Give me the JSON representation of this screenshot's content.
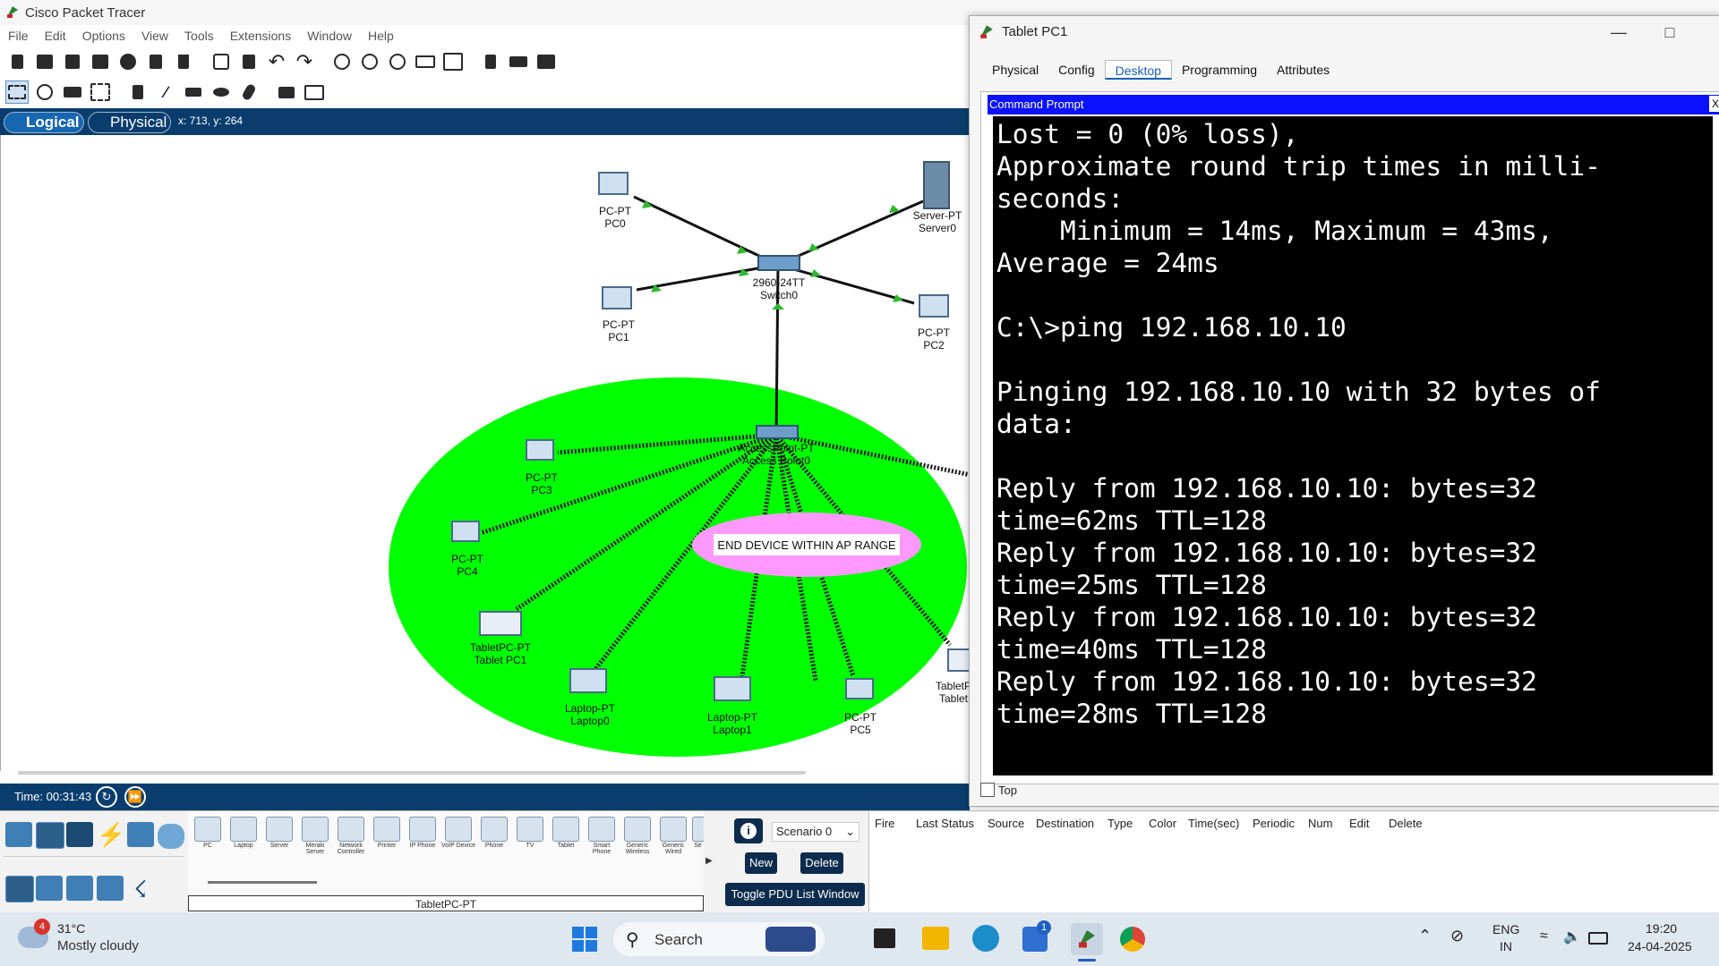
{
  "app": {
    "title": "Cisco Packet Tracer"
  },
  "menu": [
    "File",
    "Edit",
    "Options",
    "View",
    "Tools",
    "Extensions",
    "Window",
    "Help"
  ],
  "modes": {
    "logical": "Logical",
    "physical": "Physical",
    "coords": "x: 713, y: 264"
  },
  "time": {
    "label": "Time: 00:31:43"
  },
  "topology": {
    "ap_range_note": "END DEVICE WITHIN AP RANGE",
    "devices": [
      {
        "type": "PC-PT",
        "name": "PC0"
      },
      {
        "type": "Server-PT",
        "name": "Server0"
      },
      {
        "type": "2960-24TT",
        "name": "Switch0"
      },
      {
        "type": "PC-PT",
        "name": "PC1"
      },
      {
        "type": "PC-PT",
        "name": "PC2"
      },
      {
        "type": "AccessPoint-PT",
        "name": "Access Point0"
      },
      {
        "type": "PC-PT",
        "name": "PC3"
      },
      {
        "type": "PC-PT",
        "name": "PC4"
      },
      {
        "type": "TabletPC-PT",
        "name": "Tablet PC1"
      },
      {
        "type": "Laptop-PT",
        "name": "Laptop0"
      },
      {
        "type": "Laptop-PT",
        "name": "Laptop1"
      },
      {
        "type": "PC-PT",
        "name": "PC5"
      },
      {
        "type": "TabletP",
        "name": "Tablet"
      }
    ]
  },
  "device_bar": {
    "items": [
      "PC",
      "Laptop",
      "Server",
      "Meraki Server",
      "Network Controller",
      "Printer",
      "IP Phone",
      "VoIP Device",
      "Phone",
      "TV",
      "Tablet",
      "Smart Phone",
      "Generic Wireless",
      "Generic Wired",
      "Se"
    ],
    "selected_label": "TabletPC-PT"
  },
  "scenario": {
    "selected": "Scenario 0",
    "new_label": "New",
    "delete_label": "Delete",
    "toggle_label": "Toggle PDU List Window"
  },
  "pdu_columns": [
    "Fire",
    "Last Status",
    "Source",
    "Destination",
    "Type",
    "Color",
    "Time(sec)",
    "Periodic",
    "Num",
    "Edit",
    "Delete"
  ],
  "tablet_window": {
    "title": "Tablet PC1",
    "tabs": [
      "Physical",
      "Config",
      "Desktop",
      "Programming",
      "Attributes"
    ],
    "active_tab": "Desktop",
    "cmd_title": "Command Prompt",
    "cmd_close": "X",
    "console_lines": [
      "Lost = 0 (0% loss),",
      "Approximate round trip times in milli-",
      "seconds:",
      "    Minimum = 14ms, Maximum = 43ms,",
      "Average = 24ms",
      "",
      "C:\\>ping 192.168.10.10",
      "",
      "Pinging 192.168.10.10 with 32 bytes of",
      "data:",
      "",
      "Reply from 192.168.10.10: bytes=32",
      "time=62ms TTL=128",
      "Reply from 192.168.10.10: bytes=32",
      "time=25ms TTL=128",
      "Reply from 192.168.10.10: bytes=32",
      "time=40ms TTL=128",
      "Reply from 192.168.10.10: bytes=32",
      "time=28ms TTL=128"
    ],
    "top_label": "Top"
  },
  "taskbar": {
    "weather_badge": "4",
    "temp": "31°C",
    "condition": "Mostly cloudy",
    "search_placeholder": "Search",
    "lang_top": "ENG",
    "lang_bottom": "IN",
    "time": "19:20",
    "date": "24-04-2025",
    "store_badge": "1"
  },
  "colors": {
    "ap_range": "#00ff00",
    "note_bg": "#ff99ff",
    "mode_bar": "#0a3d6e",
    "cmd_title_bar": "#0b12ff"
  }
}
